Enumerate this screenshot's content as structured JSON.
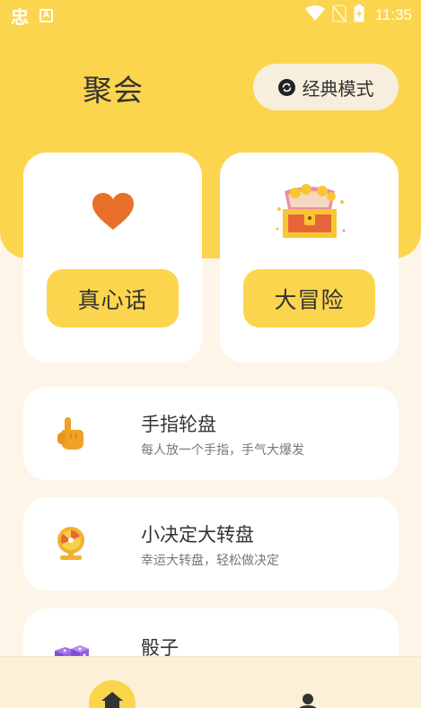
{
  "status_bar": {
    "app_glyph": "忠",
    "a_badge": "A",
    "time": "11:35"
  },
  "header": {
    "title": "聚会",
    "mode_button": "经典模式"
  },
  "cards": {
    "truth_label": "真心话",
    "dare_label": "大冒险"
  },
  "games": [
    {
      "title": "手指轮盘",
      "subtitle": "每人放一个手指，手气大爆发",
      "icon": "pointing-finger-icon"
    },
    {
      "title": "小决定大转盘",
      "subtitle": "幸运大转盘，轻松做决定",
      "icon": "spin-wheel-icon"
    },
    {
      "title": "骰子",
      "subtitle": "",
      "icon": "dice-icon"
    }
  ],
  "nav": {
    "items": [
      "home-icon",
      "profile-icon"
    ]
  },
  "colors": {
    "brand_yellow": "#FCD54E",
    "background": "#FDF5E8",
    "heart": "#E8702A"
  }
}
